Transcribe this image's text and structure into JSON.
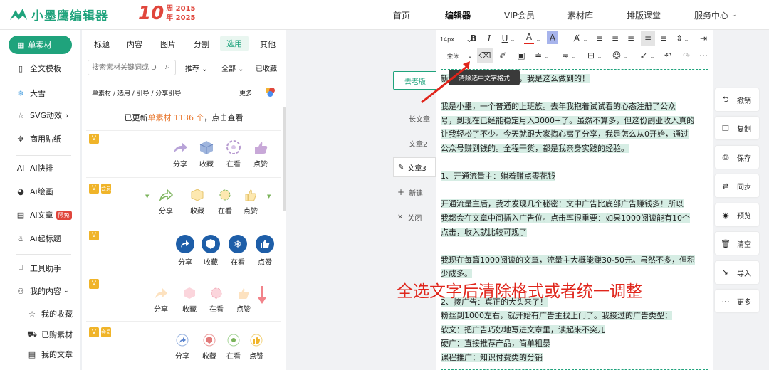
{
  "header": {
    "brand": "小墨鹰编辑器",
    "anniversary": {
      "num": "10",
      "ch1": "周",
      "y1": "2015",
      "ch2": "年",
      "y2": "2025"
    },
    "nav": [
      "首页",
      "编辑器",
      "VIP会员",
      "素材库",
      "排版课堂",
      "服务中心"
    ],
    "service_caret": "⌄"
  },
  "leftnav": {
    "items": [
      {
        "label": "单素材",
        "icon": "grid-icon"
      },
      {
        "label": "全文模板",
        "icon": "template-icon"
      },
      {
        "label": "大雪",
        "icon": "snow-icon"
      },
      {
        "label": "SVG动效",
        "icon": "star-icon",
        "suffix": "›"
      },
      {
        "label": "商用贴纸",
        "icon": "puzzle-icon"
      },
      {
        "label": "Ai快排",
        "icon": "ai-icon"
      },
      {
        "label": "Ai绘画",
        "icon": "palette-icon"
      },
      {
        "label": "Ai文章",
        "icon": "doc-icon",
        "badge": "限免"
      },
      {
        "label": "Ai起标题",
        "icon": "fire-icon"
      },
      {
        "label": "工具助手",
        "icon": "tool-icon"
      },
      {
        "label": "我的内容",
        "icon": "user-icon",
        "suffix": "⌄"
      },
      {
        "label": "我的收藏",
        "icon": "star-outline-icon"
      },
      {
        "label": "已购素材",
        "icon": "cart-icon"
      },
      {
        "label": "我的文章",
        "icon": "file-icon"
      }
    ]
  },
  "panel": {
    "tabs": [
      "标题",
      "内容",
      "图片",
      "分割",
      "选用",
      "其他"
    ],
    "active_tab": "选用",
    "search_placeholder": "搜索素材关键词或ID",
    "filters": [
      "推荐 ⌄",
      "全部 ⌄",
      "已收藏"
    ],
    "breadcrumb": "单素材 / 选用 / 引导 / 分享引导",
    "more": "更多",
    "update_prefix": "已更新",
    "update_highlight": "单素材 1136 个",
    "update_suffix": "，点击查看",
    "flag_v": "V",
    "flag_vip": "会员",
    "actions": [
      "分享",
      "收藏",
      "在看",
      "点赞"
    ]
  },
  "canvas": {
    "old_version": "去老版",
    "articles": [
      "长文章",
      "文章2",
      "文章3"
    ],
    "new": "新建",
    "close": "关闭",
    "tooltip": "清除选中文字格式",
    "overlay": "全选文字后清除格式或者统一调整",
    "lines": [
      "新手小白做公众号赚钱，我是这么做到的！",
      "",
      "我是小墨，一个普通的上班族。去年我抱着试试看的心态注册了公众",
      "号，到现在已经能稳定月入3000+了。虽然不算多，但这份副业收入真的",
      "让我轻松了不少。今天就跟大家掏心窝子分享，我是怎么从0开始，通过",
      "公众号赚到钱的。全程干货，都是我亲身实践的经验。",
      "",
      "1、开通流量主：躺着赚点零花钱",
      "",
      "开通流量主后，我才发现几个秘密：文中广告比底部广告赚钱多！所以",
      "我都会在文章中间插入广告位。点击率很重要：如果1000阅读能有10个",
      "点击，收入就比较可观了",
      "",
      "我现在每篇1000阅读的文章，流量主大概能赚30-50元。虽然不多，但积",
      "少成多。",
      "",
      "2、接广告：真正的大头来了！",
      "粉丝到1000左右，就开始有广告主找上门了。我接过的广告类型：",
      "软文：把广告巧妙地写进文章里，读起来不突兀",
      "硬广：直接推荐产品，简单粗暴",
      "课程推广：知识付费类的分销"
    ]
  },
  "editor": {
    "font_size": "14px",
    "font_family": "宋体"
  },
  "right_actions": [
    "撤销",
    "复制",
    "保存",
    "同步",
    "预览",
    "清空",
    "导入",
    "更多"
  ],
  "colors": {
    "brand": "#1fa37c",
    "accent": "#e0463c",
    "highlight": "#d6ede4"
  }
}
